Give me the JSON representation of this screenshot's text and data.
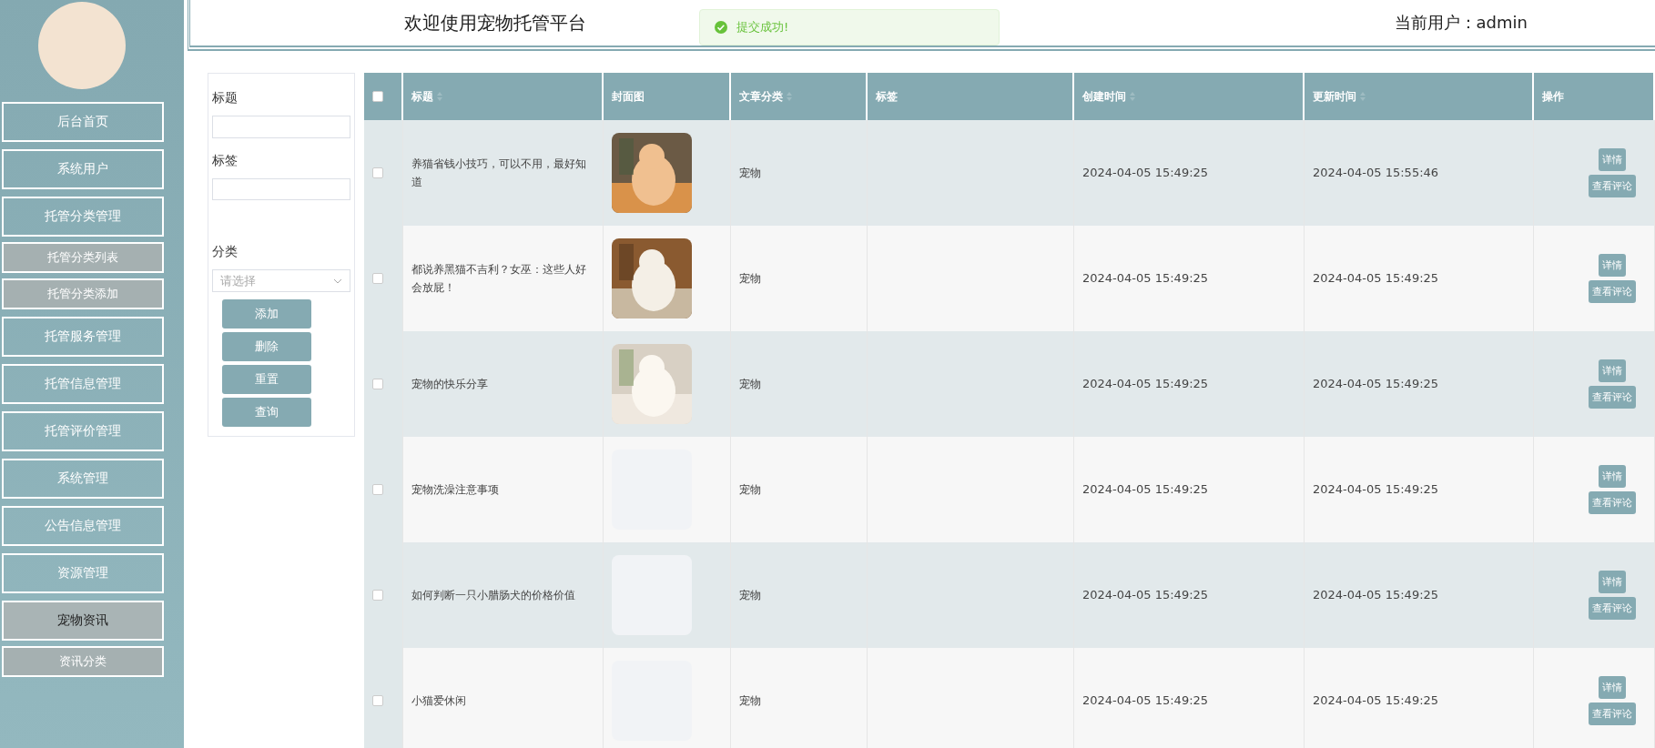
{
  "sidebar": {
    "items": [
      {
        "label": "后台首页",
        "kind": "main",
        "selected": false
      },
      {
        "label": "系统用户",
        "kind": "main",
        "selected": false
      },
      {
        "label": "托管分类管理",
        "kind": "main",
        "selected": false
      },
      {
        "label": "托管分类列表",
        "kind": "sub",
        "selected": false
      },
      {
        "label": "托管分类添加",
        "kind": "sub",
        "selected": false
      },
      {
        "label": "托管服务管理",
        "kind": "main",
        "selected": false
      },
      {
        "label": "托管信息管理",
        "kind": "main",
        "selected": false
      },
      {
        "label": "托管评价管理",
        "kind": "main",
        "selected": false
      },
      {
        "label": "系统管理",
        "kind": "main",
        "selected": false
      },
      {
        "label": "公告信息管理",
        "kind": "main",
        "selected": false
      },
      {
        "label": "资源管理",
        "kind": "main",
        "selected": false
      },
      {
        "label": "宠物资讯",
        "kind": "main",
        "selected": true
      },
      {
        "label": "资讯分类",
        "kind": "sub",
        "selected": false
      }
    ]
  },
  "header": {
    "title": "欢迎使用宠物托管平台",
    "user": "当前用户：admin"
  },
  "toast": {
    "message": "提交成功!"
  },
  "filter": {
    "fields": [
      {
        "label": "标题",
        "kind": "text"
      },
      {
        "label": "标签",
        "kind": "text"
      },
      {
        "label": "分类",
        "kind": "select",
        "placeholder": "请选择"
      }
    ],
    "buttons": [
      "添加",
      "删除",
      "重置",
      "查询"
    ]
  },
  "table": {
    "select_all": {
      "checked": false
    },
    "columns": [
      {
        "label": "标题",
        "sortable": true
      },
      {
        "label": "封面图",
        "sortable": false
      },
      {
        "label": "文章分类",
        "sortable": true
      },
      {
        "label": "标签",
        "sortable": false
      },
      {
        "label": "创建时间",
        "sortable": true
      },
      {
        "label": "更新时间",
        "sortable": true
      },
      {
        "label": "操作",
        "sortable": false
      }
    ],
    "rows": [
      {
        "checked": false,
        "title": "养猫省钱小技巧，可以不用，最好知道",
        "cover": {
          "kind": "picture"
        },
        "category": "宠物",
        "created": "2024-04-05 15:49:25",
        "updated": "2024-04-05 15:55:46",
        "actions": [
          "详情",
          "查看评论"
        ]
      },
      {
        "checked": false,
        "title": "都说养黑猫不吉利？女巫：这些人好会放屁！",
        "cover": {
          "kind": "picture"
        },
        "category": "宠物",
        "created": "2024-04-05 15:49:25",
        "updated": "2024-04-05 15:49:25",
        "actions": [
          "详情",
          "查看评论"
        ]
      },
      {
        "checked": false,
        "title": "宠物的快乐分享",
        "cover": {
          "kind": "picture"
        },
        "category": "宠物",
        "created": "2024-04-05 15:49:25",
        "updated": "2024-04-05 15:49:25",
        "actions": [
          "详情",
          "查看评论"
        ]
      },
      {
        "checked": false,
        "title": "宠物洗澡注意事项",
        "cover": {
          "kind": "empty"
        },
        "category": "宠物",
        "created": "2024-04-05 15:49:25",
        "updated": "2024-04-05 15:49:25",
        "actions": [
          "详情",
          "查看评论"
        ]
      },
      {
        "checked": false,
        "title": "如何判断一只小腊肠犬的价格价值",
        "cover": {
          "kind": "empty"
        },
        "category": "宠物",
        "created": "2024-04-05 15:49:25",
        "updated": "2024-04-05 15:49:25",
        "actions": [
          "详情",
          "查看评论"
        ]
      },
      {
        "checked": false,
        "title": "小猫爱休闲",
        "cover": {
          "kind": "empty"
        },
        "category": "宠物",
        "created": "2024-04-05 15:49:25",
        "updated": "2024-04-05 15:49:25",
        "actions": [
          "详情",
          "查看评论"
        ]
      }
    ]
  }
}
